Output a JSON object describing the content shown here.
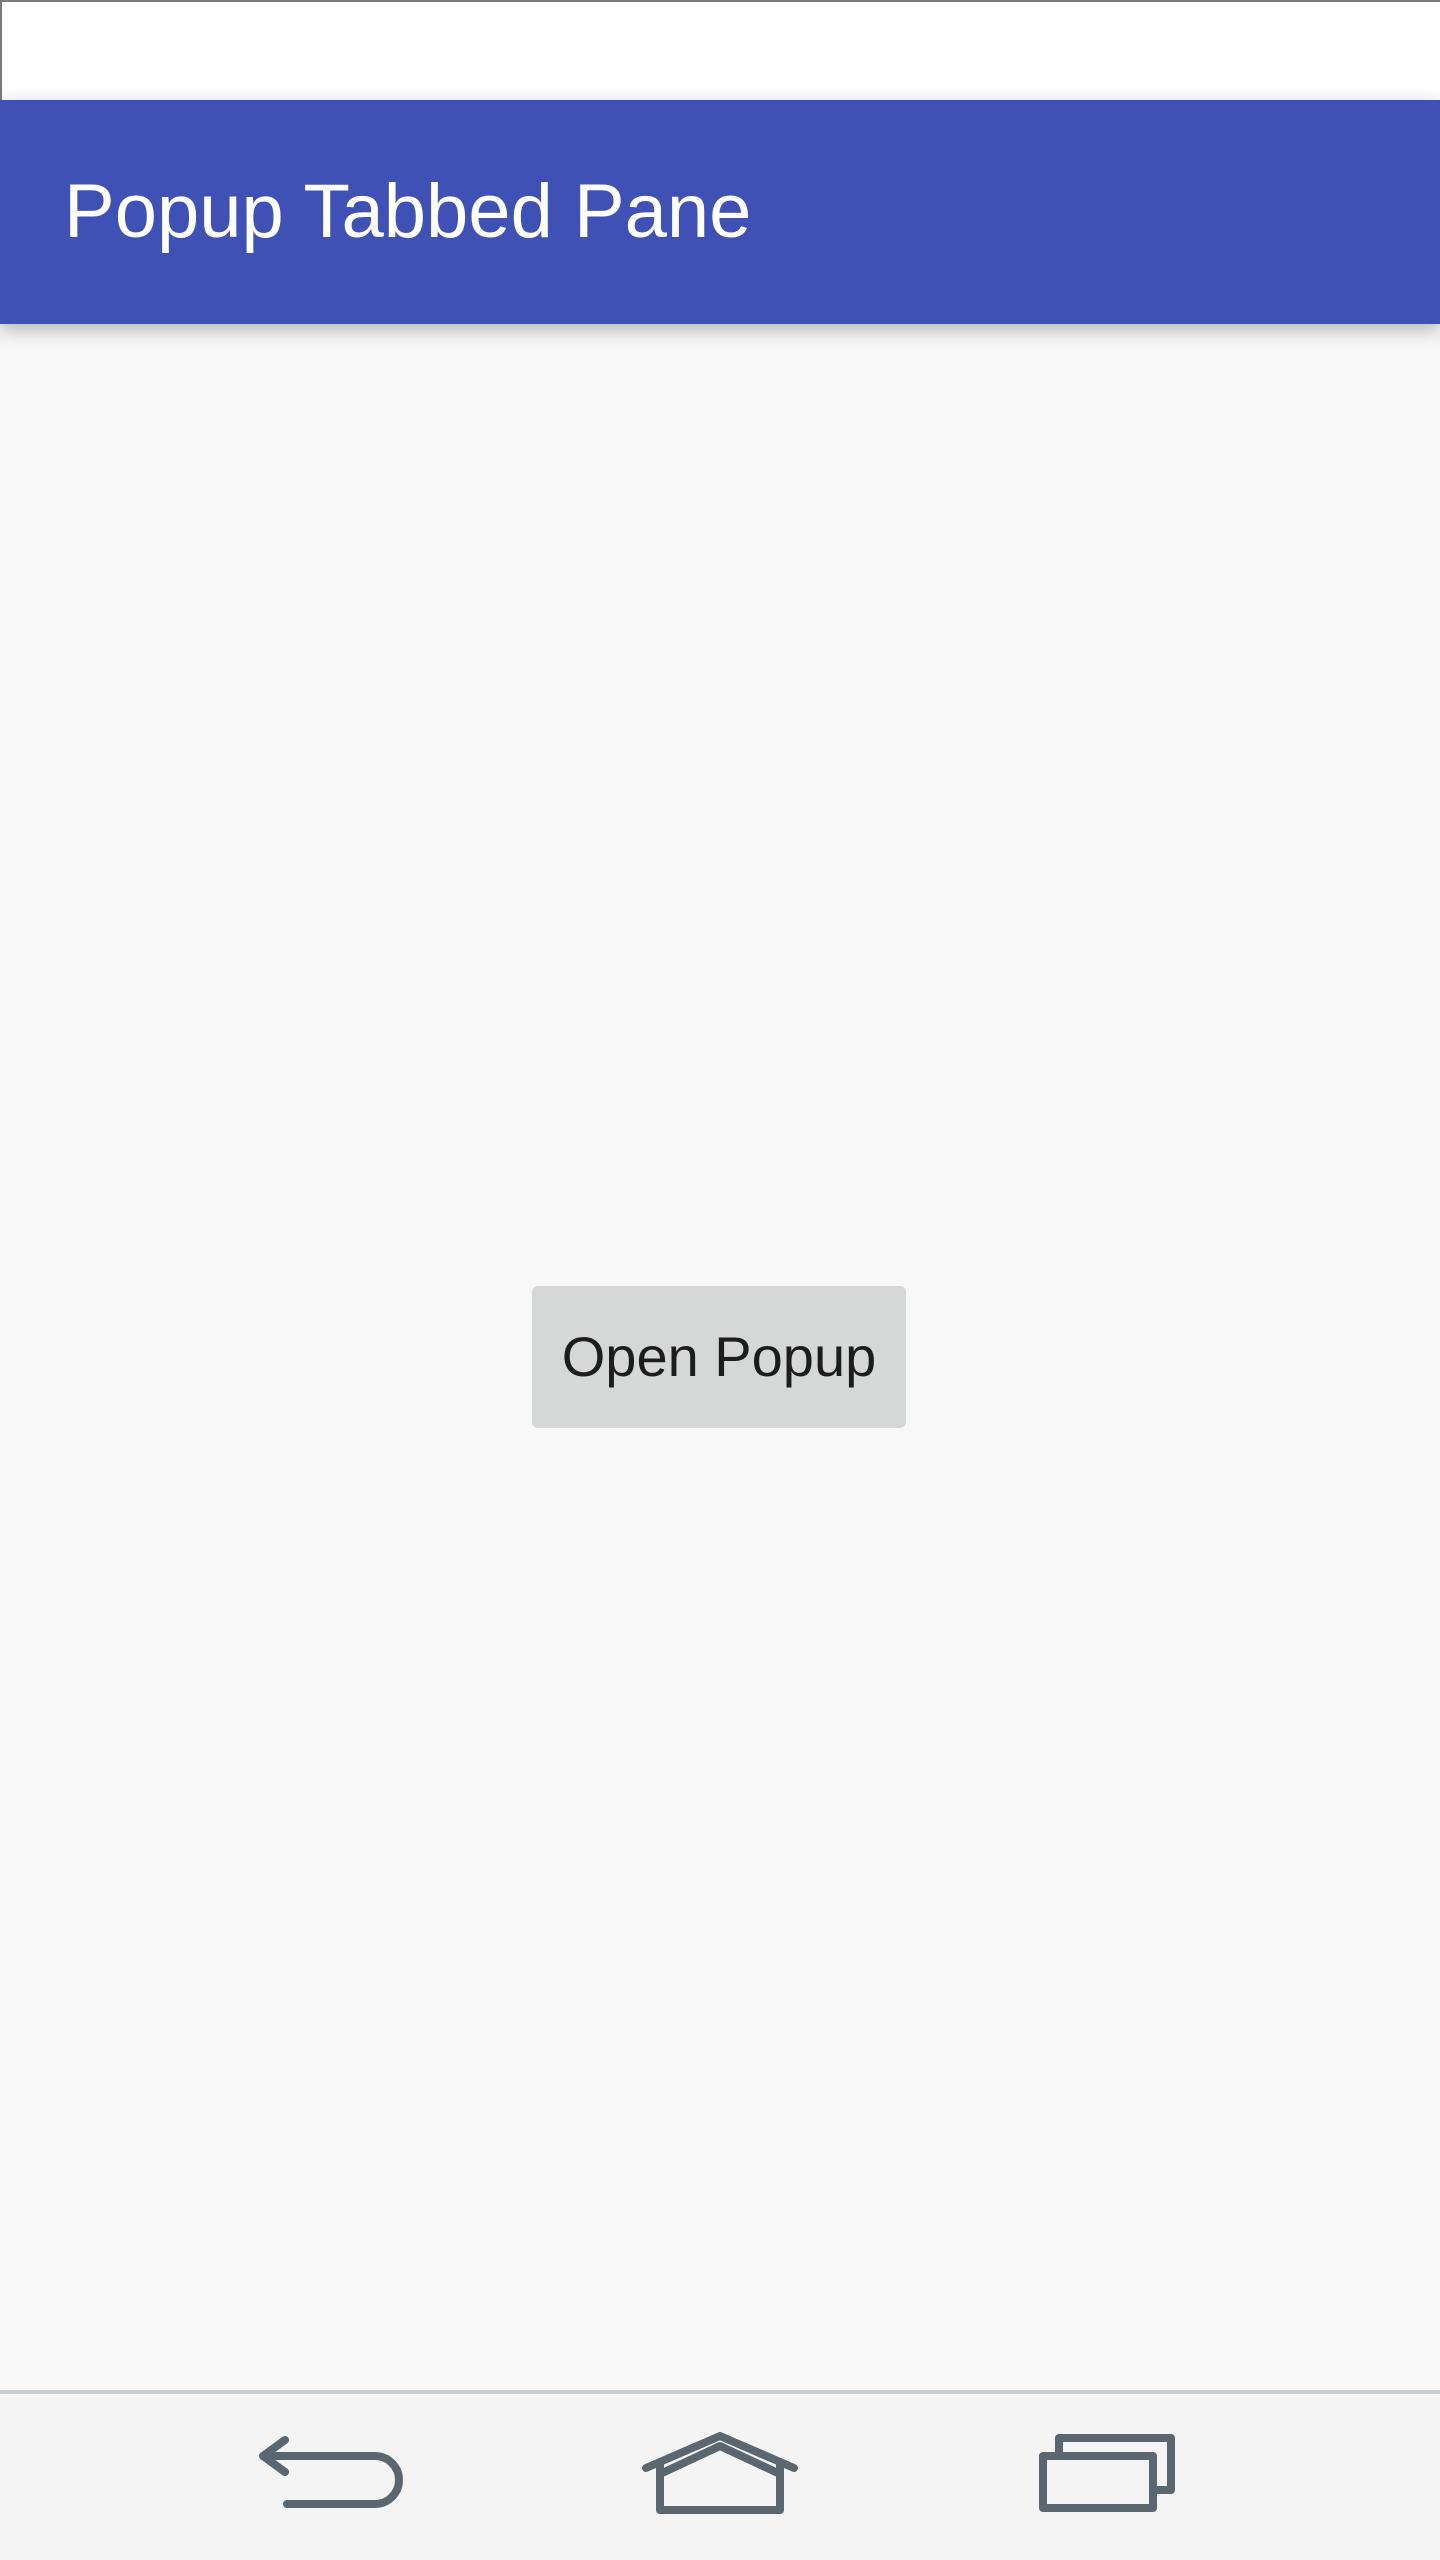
{
  "app_bar": {
    "title": "Popup Tabbed Pane",
    "color": "#3f51b5"
  },
  "main": {
    "open_popup_label": "Open Popup"
  },
  "navigation": {
    "back_icon": "back-icon",
    "home_icon": "home-icon",
    "recents_icon": "recents-icon",
    "icon_color": "#5a6670"
  }
}
